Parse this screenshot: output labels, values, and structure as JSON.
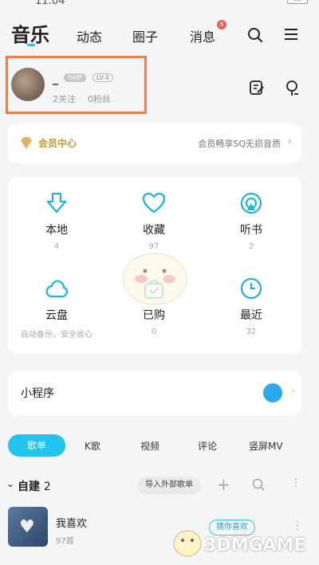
{
  "status": {
    "time": "11:04",
    "battery": "86"
  },
  "nav": {
    "tabs": [
      "音乐",
      "动态",
      "圈子",
      "消息"
    ],
    "message_badge": "6"
  },
  "profile": {
    "name": "_",
    "svip": "SVIP",
    "level": "LV.4",
    "following": "2关注",
    "fans": "0粉丝"
  },
  "vip": {
    "label": "会员中心",
    "promo": "会员畅享SQ无损音质"
  },
  "grid": [
    {
      "name": "本地",
      "sub": "4"
    },
    {
      "name": "收藏",
      "sub": "97"
    },
    {
      "name": "听书",
      "sub": "2"
    },
    {
      "name": "云盘",
      "sub": "自动备份，安全省心"
    },
    {
      "name": "已购",
      "sub": "0"
    },
    {
      "name": "最近",
      "sub": "32"
    }
  ],
  "mini": {
    "label": "小程序"
  },
  "tabs": [
    "歌单",
    "K歌",
    "视频",
    "评论",
    "竖屏MV"
  ],
  "self_built": {
    "label": "自建",
    "count": "2",
    "import_label": "导入外部歌单"
  },
  "playlist": {
    "title": "我喜欢",
    "count": "97首",
    "guess": "猜你喜欢"
  },
  "watermark": {
    "text": "3DMGAME"
  },
  "colors": {
    "accent": "#22c3ee",
    "vip_gold": "#c9963e",
    "highlight_box": "#ee7d4f"
  }
}
